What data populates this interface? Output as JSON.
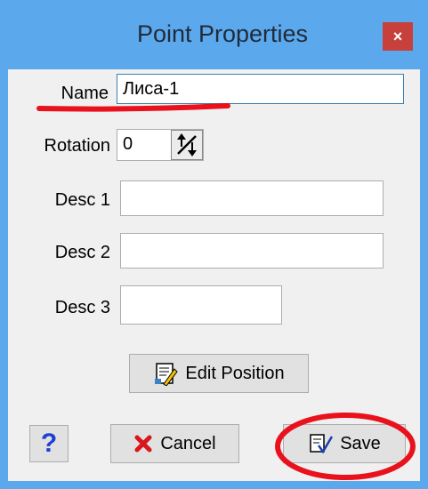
{
  "window": {
    "title": "Point Properties",
    "close_label": "×"
  },
  "form": {
    "name": {
      "label": "Name",
      "value": "Лиса-1"
    },
    "rotation": {
      "label": "Rotation",
      "value": "0"
    },
    "desc1": {
      "label": "Desc 1",
      "value": ""
    },
    "desc2": {
      "label": "Desc 2",
      "value": ""
    },
    "desc3": {
      "label": "Desc 3",
      "value": ""
    }
  },
  "buttons": {
    "edit_position": "Edit Position",
    "help": "?",
    "cancel": "Cancel",
    "save": "Save"
  },
  "icons": {
    "spin": "spin-arrows-icon",
    "edit_position": "edit-position-icon",
    "help": "help-icon",
    "cancel": "cancel-x-icon",
    "save": "save-check-icon"
  },
  "colors": {
    "titlebar": "#5ca8ec",
    "close": "#c8403b",
    "annotation": "#e8111c",
    "cancel_x": "#d9161c",
    "help_blue": "#1e3fd0"
  }
}
